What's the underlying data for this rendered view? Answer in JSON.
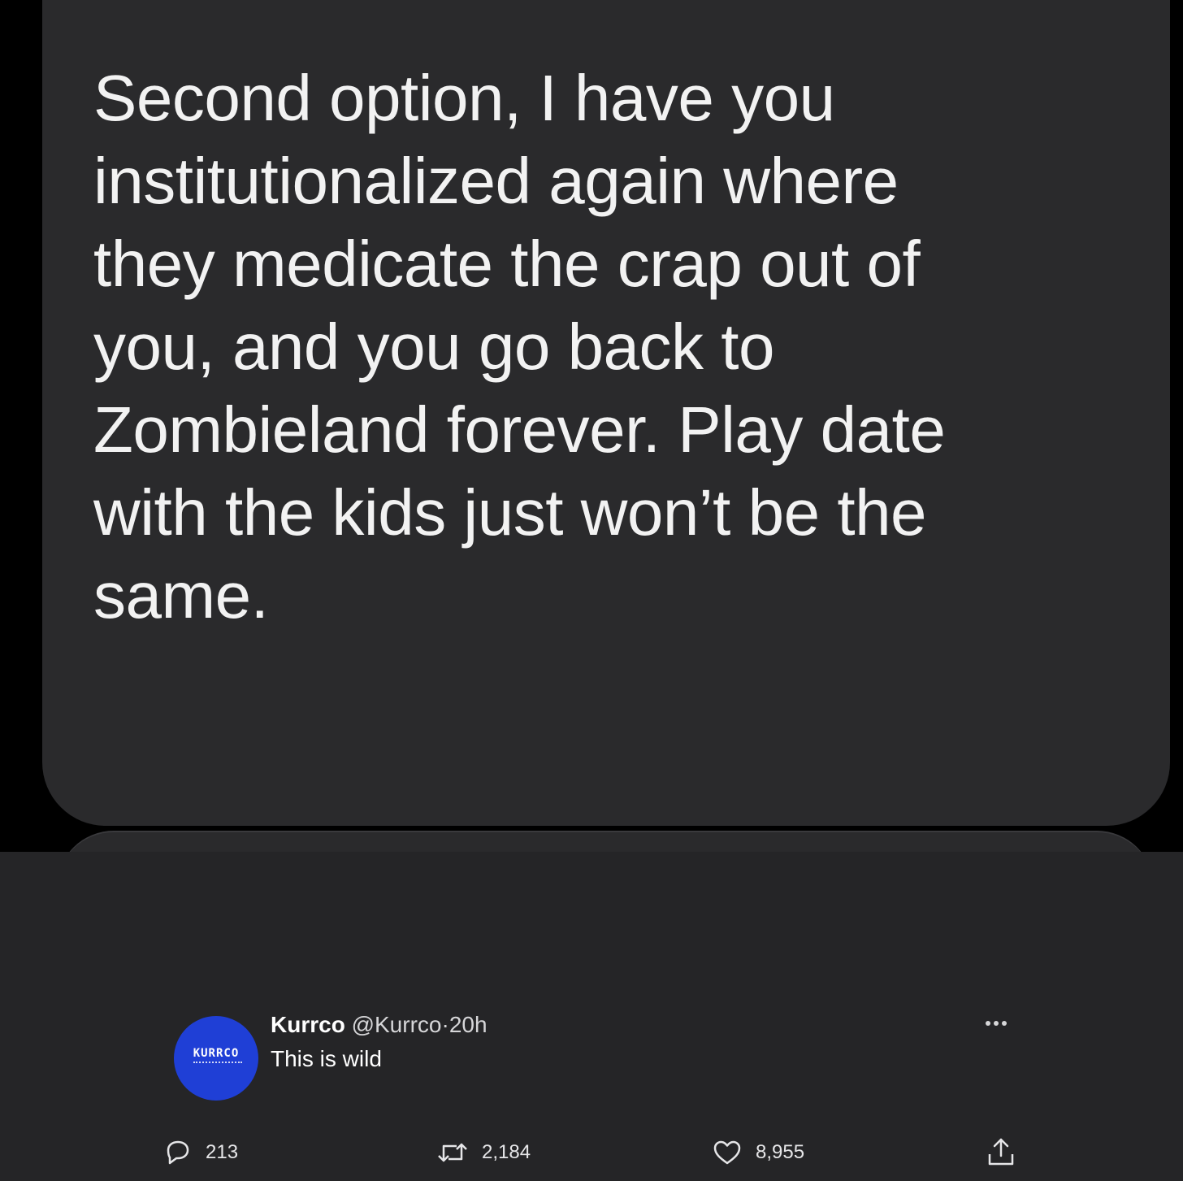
{
  "screenshot": {
    "message_text": "Second option, I have you\ninstitutionalized again where\nthey medicate the crap out of\nyou, and you go back to\nZombieland forever. Play date\nwith the kids just won’t be the\nsame."
  },
  "tweet": {
    "avatar_text": "KURRCO",
    "display_name": "Kurrco",
    "handle": "@Kurrco",
    "separator": "·",
    "time": "20h",
    "body": "This is wild",
    "more_label": "...",
    "actions": {
      "replies": "213",
      "retweets": "2,184",
      "likes": "8,955"
    }
  },
  "colors": {
    "background": "#252527",
    "bubble": "#2a2a2c",
    "avatar": "#1f3fd6"
  },
  "icons": [
    "reply-icon",
    "retweet-icon",
    "like-icon",
    "share-icon",
    "more-icon"
  ]
}
